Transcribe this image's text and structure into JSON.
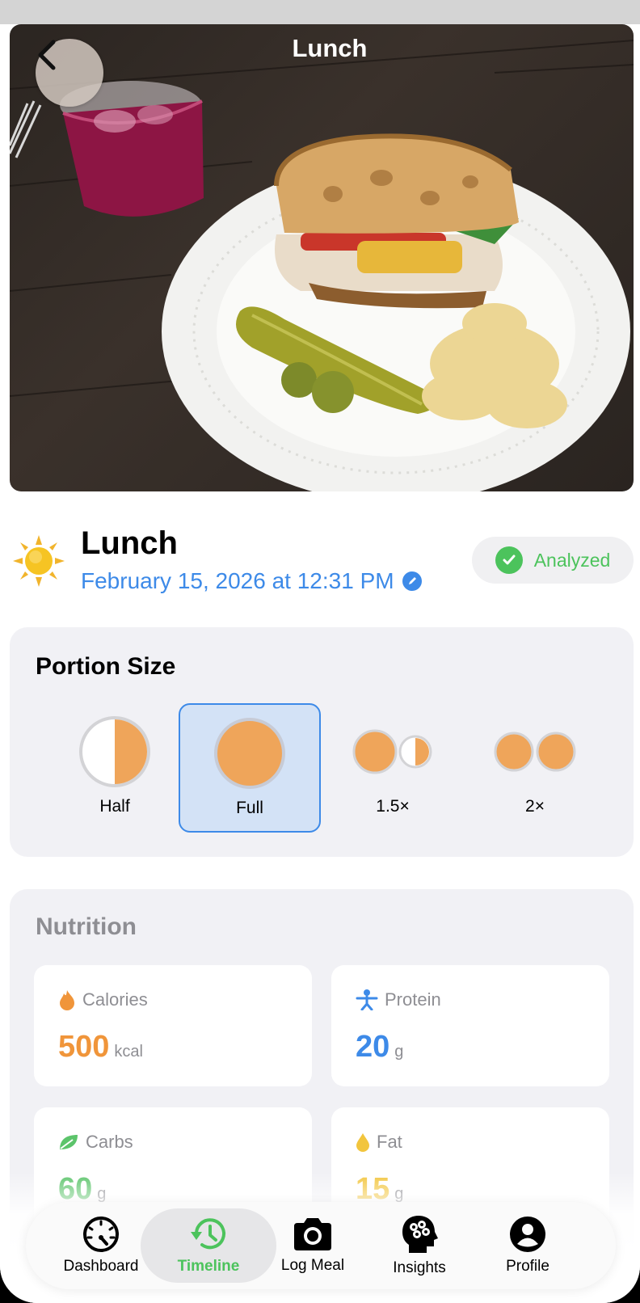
{
  "nav": {
    "title": "Lunch"
  },
  "meal": {
    "title": "Lunch",
    "datetime": "February 15, 2026 at 12:31 PM",
    "status": "Analyzed"
  },
  "portion": {
    "title": "Portion Size",
    "options": [
      {
        "label": "Half"
      },
      {
        "label": "Full"
      },
      {
        "label": "1.5×"
      },
      {
        "label": "2×"
      }
    ],
    "selected": "Full"
  },
  "nutrition": {
    "title": "Nutrition",
    "items": [
      {
        "label": "Calories",
        "value": "500",
        "unit": "kcal",
        "color": "#f0953a",
        "icon": "flame-icon"
      },
      {
        "label": "Protein",
        "value": "20",
        "unit": "g",
        "color": "#3d8ae8",
        "icon": "person-icon"
      },
      {
        "label": "Carbs",
        "value": "60",
        "unit": "g",
        "color": "#5cc46b",
        "icon": "leaf-icon"
      },
      {
        "label": "Fat",
        "value": "15",
        "unit": "g",
        "color": "#f2c53d",
        "icon": "drop-icon"
      }
    ]
  },
  "tabs": [
    {
      "label": "Dashboard",
      "icon": "gauge-icon"
    },
    {
      "label": "Timeline",
      "icon": "history-icon"
    },
    {
      "label": "Log Meal",
      "icon": "camera-icon"
    },
    {
      "label": "Insights",
      "icon": "brain-head-icon"
    },
    {
      "label": "Profile",
      "icon": "person-circle-icon"
    }
  ],
  "active_tab": "Timeline",
  "colors": {
    "accent": "#3d8ae8",
    "success": "#4cc35c",
    "portion": "#efa55a"
  }
}
